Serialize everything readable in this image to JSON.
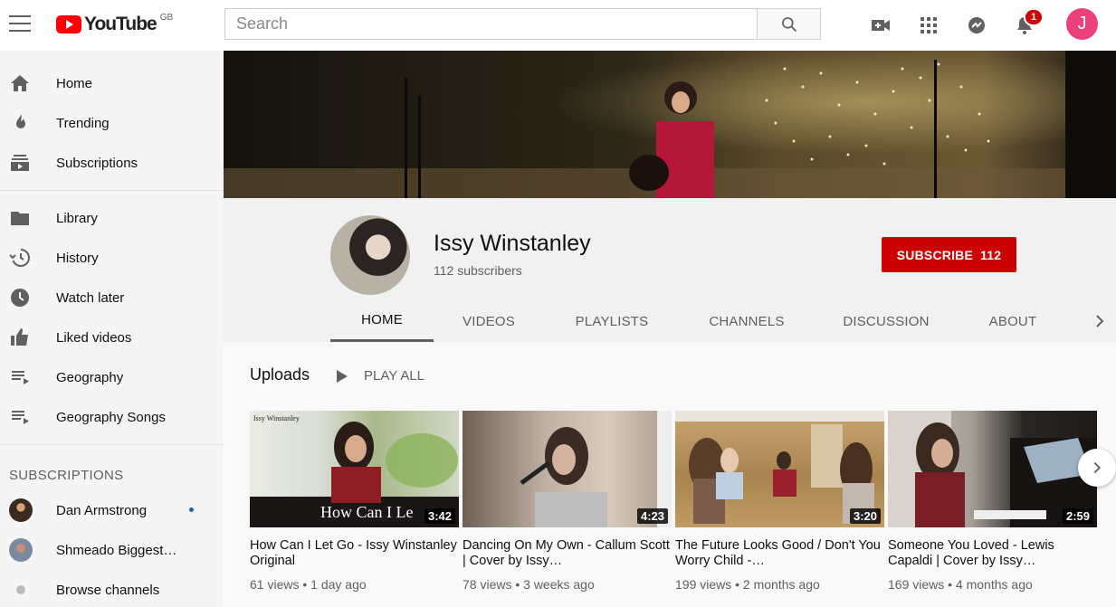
{
  "topbar": {
    "logo_text": "YouTube",
    "logo_country": "GB",
    "search_placeholder": "Search",
    "notification_count": "1",
    "account_initial": "J"
  },
  "sidebar": {
    "items": [
      {
        "label": "Home",
        "icon": "home-icon"
      },
      {
        "label": "Trending",
        "icon": "trending-icon"
      },
      {
        "label": "Subscriptions",
        "icon": "subscriptions-icon"
      }
    ],
    "library_items": [
      {
        "label": "Library",
        "icon": "library-icon"
      },
      {
        "label": "History",
        "icon": "history-icon"
      },
      {
        "label": "Watch later",
        "icon": "watch-later-icon"
      },
      {
        "label": "Liked videos",
        "icon": "liked-icon"
      },
      {
        "label": "Geography",
        "icon": "playlist-icon"
      },
      {
        "label": "Geography Songs",
        "icon": "playlist-icon"
      }
    ],
    "subscriptions_heading": "SUBSCRIPTIONS",
    "subscriptions": [
      {
        "label": "Dan Armstrong"
      },
      {
        "label": "Shmeado Biggest…"
      },
      {
        "label": "Browse channels"
      }
    ]
  },
  "channel": {
    "name": "Issy Winstanley",
    "subscribers": "112 subscribers",
    "subscribe_label": "SUBSCRIBE",
    "subscribe_count": "112",
    "tabs": [
      "HOME",
      "VIDEOS",
      "PLAYLISTS",
      "CHANNELS",
      "DISCUSSION",
      "ABOUT"
    ]
  },
  "uploads": {
    "heading": "Uploads",
    "play_all": "PLAY ALL",
    "videos": [
      {
        "title": "How Can I Let Go - Issy Winstanley Original",
        "meta": "61 views • 1 day ago",
        "duration": "3:42",
        "thumb_overlay": "How Can I Le",
        "thumb_caption": "Issy Winstanley"
      },
      {
        "title": "Dancing On My Own - Callum Scott | Cover by Issy…",
        "meta": "78 views • 3 weeks ago",
        "duration": "4:23"
      },
      {
        "title": "The Future Looks Good / Don't You Worry Child -…",
        "meta": "199 views • 2 months ago",
        "duration": "3:20"
      },
      {
        "title": "Someone You Loved - Lewis Capaldi | Cover by Issy…",
        "meta": "169 views • 4 months ago",
        "duration": "2:59"
      }
    ]
  },
  "colors": {
    "brand_red": "#cc0000",
    "youtube_red": "#ff0000",
    "avatar_pink": "#ec407a"
  }
}
